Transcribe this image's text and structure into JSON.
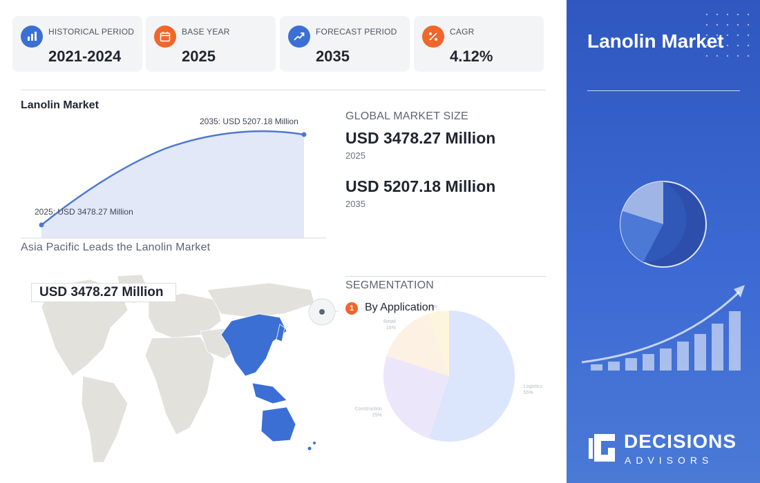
{
  "stats": [
    {
      "label": "HISTORICAL PERIOD",
      "value": "2021-2024",
      "icon": "bar-chart-icon",
      "color": "#3b6fd4"
    },
    {
      "label": "BASE YEAR",
      "value": "2025",
      "icon": "calendar-icon",
      "color": "#f0662b"
    },
    {
      "label": "FORECAST PERIOD",
      "value": "2035",
      "icon": "trend-up-icon",
      "color": "#3b6fd4"
    },
    {
      "label": "CAGR",
      "value": "4.12%",
      "icon": "percent-icon",
      "color": "#f0662b"
    }
  ],
  "growth": {
    "title": "Lanolin Market",
    "start_label": "2025: USD 3478.27 Million",
    "end_label": "2035: USD 5207.18 Million"
  },
  "market_size": {
    "heading": "GLOBAL MARKET SIZE",
    "value_2025": "USD 3478.27 Million",
    "year_2025": "2025",
    "value_2035": "USD 5207.18 Million",
    "year_2035": "2035"
  },
  "region": {
    "title": "Asia Pacific Leads the Lanolin Market",
    "callout": "USD 3478.27 Million"
  },
  "segmentation": {
    "heading": "SEGMENTATION",
    "index": "1",
    "name": "By Application"
  },
  "chart_data": {
    "type": "pie",
    "title": "",
    "categories": [
      "Logistics",
      "Construction",
      "Retail",
      "Others"
    ],
    "values": [
      55,
      25,
      15,
      5
    ],
    "colors": [
      "#dbe5fb",
      "#ece6fb",
      "#fdf1e4",
      "#fdf6dd"
    ]
  },
  "panel": {
    "title": "Lanolin Market",
    "brand_top": "DECISIONS",
    "brand_bottom": "ADVISORS"
  },
  "colors": {
    "accent_blue": "#3b6fd4",
    "accent_orange": "#f0662b",
    "panel_blue": "#2f57bf"
  }
}
